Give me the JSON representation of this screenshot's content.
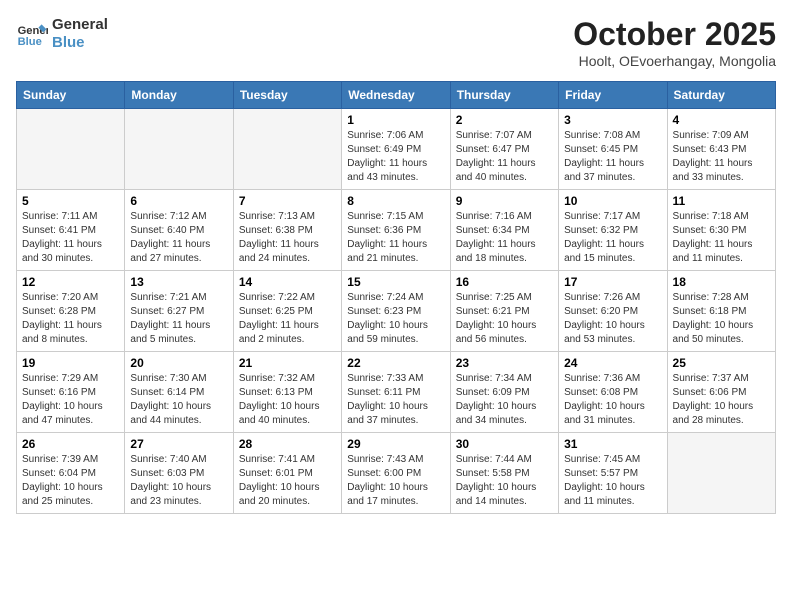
{
  "header": {
    "logo_line1": "General",
    "logo_line2": "Blue",
    "month_title": "October 2025",
    "subtitle": "Hoolt, OEvoerhangay, Mongolia"
  },
  "weekdays": [
    "Sunday",
    "Monday",
    "Tuesday",
    "Wednesday",
    "Thursday",
    "Friday",
    "Saturday"
  ],
  "weeks": [
    [
      {
        "day": "",
        "info": ""
      },
      {
        "day": "",
        "info": ""
      },
      {
        "day": "",
        "info": ""
      },
      {
        "day": "1",
        "info": "Sunrise: 7:06 AM\nSunset: 6:49 PM\nDaylight: 11 hours\nand 43 minutes."
      },
      {
        "day": "2",
        "info": "Sunrise: 7:07 AM\nSunset: 6:47 PM\nDaylight: 11 hours\nand 40 minutes."
      },
      {
        "day": "3",
        "info": "Sunrise: 7:08 AM\nSunset: 6:45 PM\nDaylight: 11 hours\nand 37 minutes."
      },
      {
        "day": "4",
        "info": "Sunrise: 7:09 AM\nSunset: 6:43 PM\nDaylight: 11 hours\nand 33 minutes."
      }
    ],
    [
      {
        "day": "5",
        "info": "Sunrise: 7:11 AM\nSunset: 6:41 PM\nDaylight: 11 hours\nand 30 minutes."
      },
      {
        "day": "6",
        "info": "Sunrise: 7:12 AM\nSunset: 6:40 PM\nDaylight: 11 hours\nand 27 minutes."
      },
      {
        "day": "7",
        "info": "Sunrise: 7:13 AM\nSunset: 6:38 PM\nDaylight: 11 hours\nand 24 minutes."
      },
      {
        "day": "8",
        "info": "Sunrise: 7:15 AM\nSunset: 6:36 PM\nDaylight: 11 hours\nand 21 minutes."
      },
      {
        "day": "9",
        "info": "Sunrise: 7:16 AM\nSunset: 6:34 PM\nDaylight: 11 hours\nand 18 minutes."
      },
      {
        "day": "10",
        "info": "Sunrise: 7:17 AM\nSunset: 6:32 PM\nDaylight: 11 hours\nand 15 minutes."
      },
      {
        "day": "11",
        "info": "Sunrise: 7:18 AM\nSunset: 6:30 PM\nDaylight: 11 hours\nand 11 minutes."
      }
    ],
    [
      {
        "day": "12",
        "info": "Sunrise: 7:20 AM\nSunset: 6:28 PM\nDaylight: 11 hours\nand 8 minutes."
      },
      {
        "day": "13",
        "info": "Sunrise: 7:21 AM\nSunset: 6:27 PM\nDaylight: 11 hours\nand 5 minutes."
      },
      {
        "day": "14",
        "info": "Sunrise: 7:22 AM\nSunset: 6:25 PM\nDaylight: 11 hours\nand 2 minutes."
      },
      {
        "day": "15",
        "info": "Sunrise: 7:24 AM\nSunset: 6:23 PM\nDaylight: 10 hours\nand 59 minutes."
      },
      {
        "day": "16",
        "info": "Sunrise: 7:25 AM\nSunset: 6:21 PM\nDaylight: 10 hours\nand 56 minutes."
      },
      {
        "day": "17",
        "info": "Sunrise: 7:26 AM\nSunset: 6:20 PM\nDaylight: 10 hours\nand 53 minutes."
      },
      {
        "day": "18",
        "info": "Sunrise: 7:28 AM\nSunset: 6:18 PM\nDaylight: 10 hours\nand 50 minutes."
      }
    ],
    [
      {
        "day": "19",
        "info": "Sunrise: 7:29 AM\nSunset: 6:16 PM\nDaylight: 10 hours\nand 47 minutes."
      },
      {
        "day": "20",
        "info": "Sunrise: 7:30 AM\nSunset: 6:14 PM\nDaylight: 10 hours\nand 44 minutes."
      },
      {
        "day": "21",
        "info": "Sunrise: 7:32 AM\nSunset: 6:13 PM\nDaylight: 10 hours\nand 40 minutes."
      },
      {
        "day": "22",
        "info": "Sunrise: 7:33 AM\nSunset: 6:11 PM\nDaylight: 10 hours\nand 37 minutes."
      },
      {
        "day": "23",
        "info": "Sunrise: 7:34 AM\nSunset: 6:09 PM\nDaylight: 10 hours\nand 34 minutes."
      },
      {
        "day": "24",
        "info": "Sunrise: 7:36 AM\nSunset: 6:08 PM\nDaylight: 10 hours\nand 31 minutes."
      },
      {
        "day": "25",
        "info": "Sunrise: 7:37 AM\nSunset: 6:06 PM\nDaylight: 10 hours\nand 28 minutes."
      }
    ],
    [
      {
        "day": "26",
        "info": "Sunrise: 7:39 AM\nSunset: 6:04 PM\nDaylight: 10 hours\nand 25 minutes."
      },
      {
        "day": "27",
        "info": "Sunrise: 7:40 AM\nSunset: 6:03 PM\nDaylight: 10 hours\nand 23 minutes."
      },
      {
        "day": "28",
        "info": "Sunrise: 7:41 AM\nSunset: 6:01 PM\nDaylight: 10 hours\nand 20 minutes."
      },
      {
        "day": "29",
        "info": "Sunrise: 7:43 AM\nSunset: 6:00 PM\nDaylight: 10 hours\nand 17 minutes."
      },
      {
        "day": "30",
        "info": "Sunrise: 7:44 AM\nSunset: 5:58 PM\nDaylight: 10 hours\nand 14 minutes."
      },
      {
        "day": "31",
        "info": "Sunrise: 7:45 AM\nSunset: 5:57 PM\nDaylight: 10 hours\nand 11 minutes."
      },
      {
        "day": "",
        "info": ""
      }
    ]
  ]
}
